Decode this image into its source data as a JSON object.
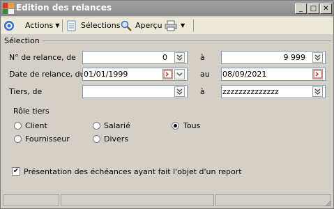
{
  "window": {
    "title": "Edition des relances",
    "minimize": "_",
    "maximize": "□",
    "close": "✕"
  },
  "toolbar": {
    "actions_label": "Actions",
    "selections_label": "Sélections",
    "apercu_label": "Aperçu"
  },
  "group": {
    "label": "Sélection"
  },
  "fields": {
    "relance_no_label": "N° de relance, de",
    "relance_no_from": "0",
    "relance_no_to": "9 999",
    "date_label": "Date de relance, du",
    "date_from": "01/01/1999",
    "date_to": "08/09/2021",
    "tiers_label": "Tiers, de",
    "tiers_from": "",
    "tiers_to": "zzzzzzzzzzzzzz",
    "a_label": "à",
    "au_label": "au"
  },
  "role": {
    "label": "Rôle tiers",
    "options": [
      "Client",
      "Salarié",
      "Tous",
      "Fournisseur",
      "Divers"
    ],
    "selected": "Tous"
  },
  "report_option": {
    "label": "Présentation des échéances ayant fait l'objet d'un report",
    "checked": true
  }
}
